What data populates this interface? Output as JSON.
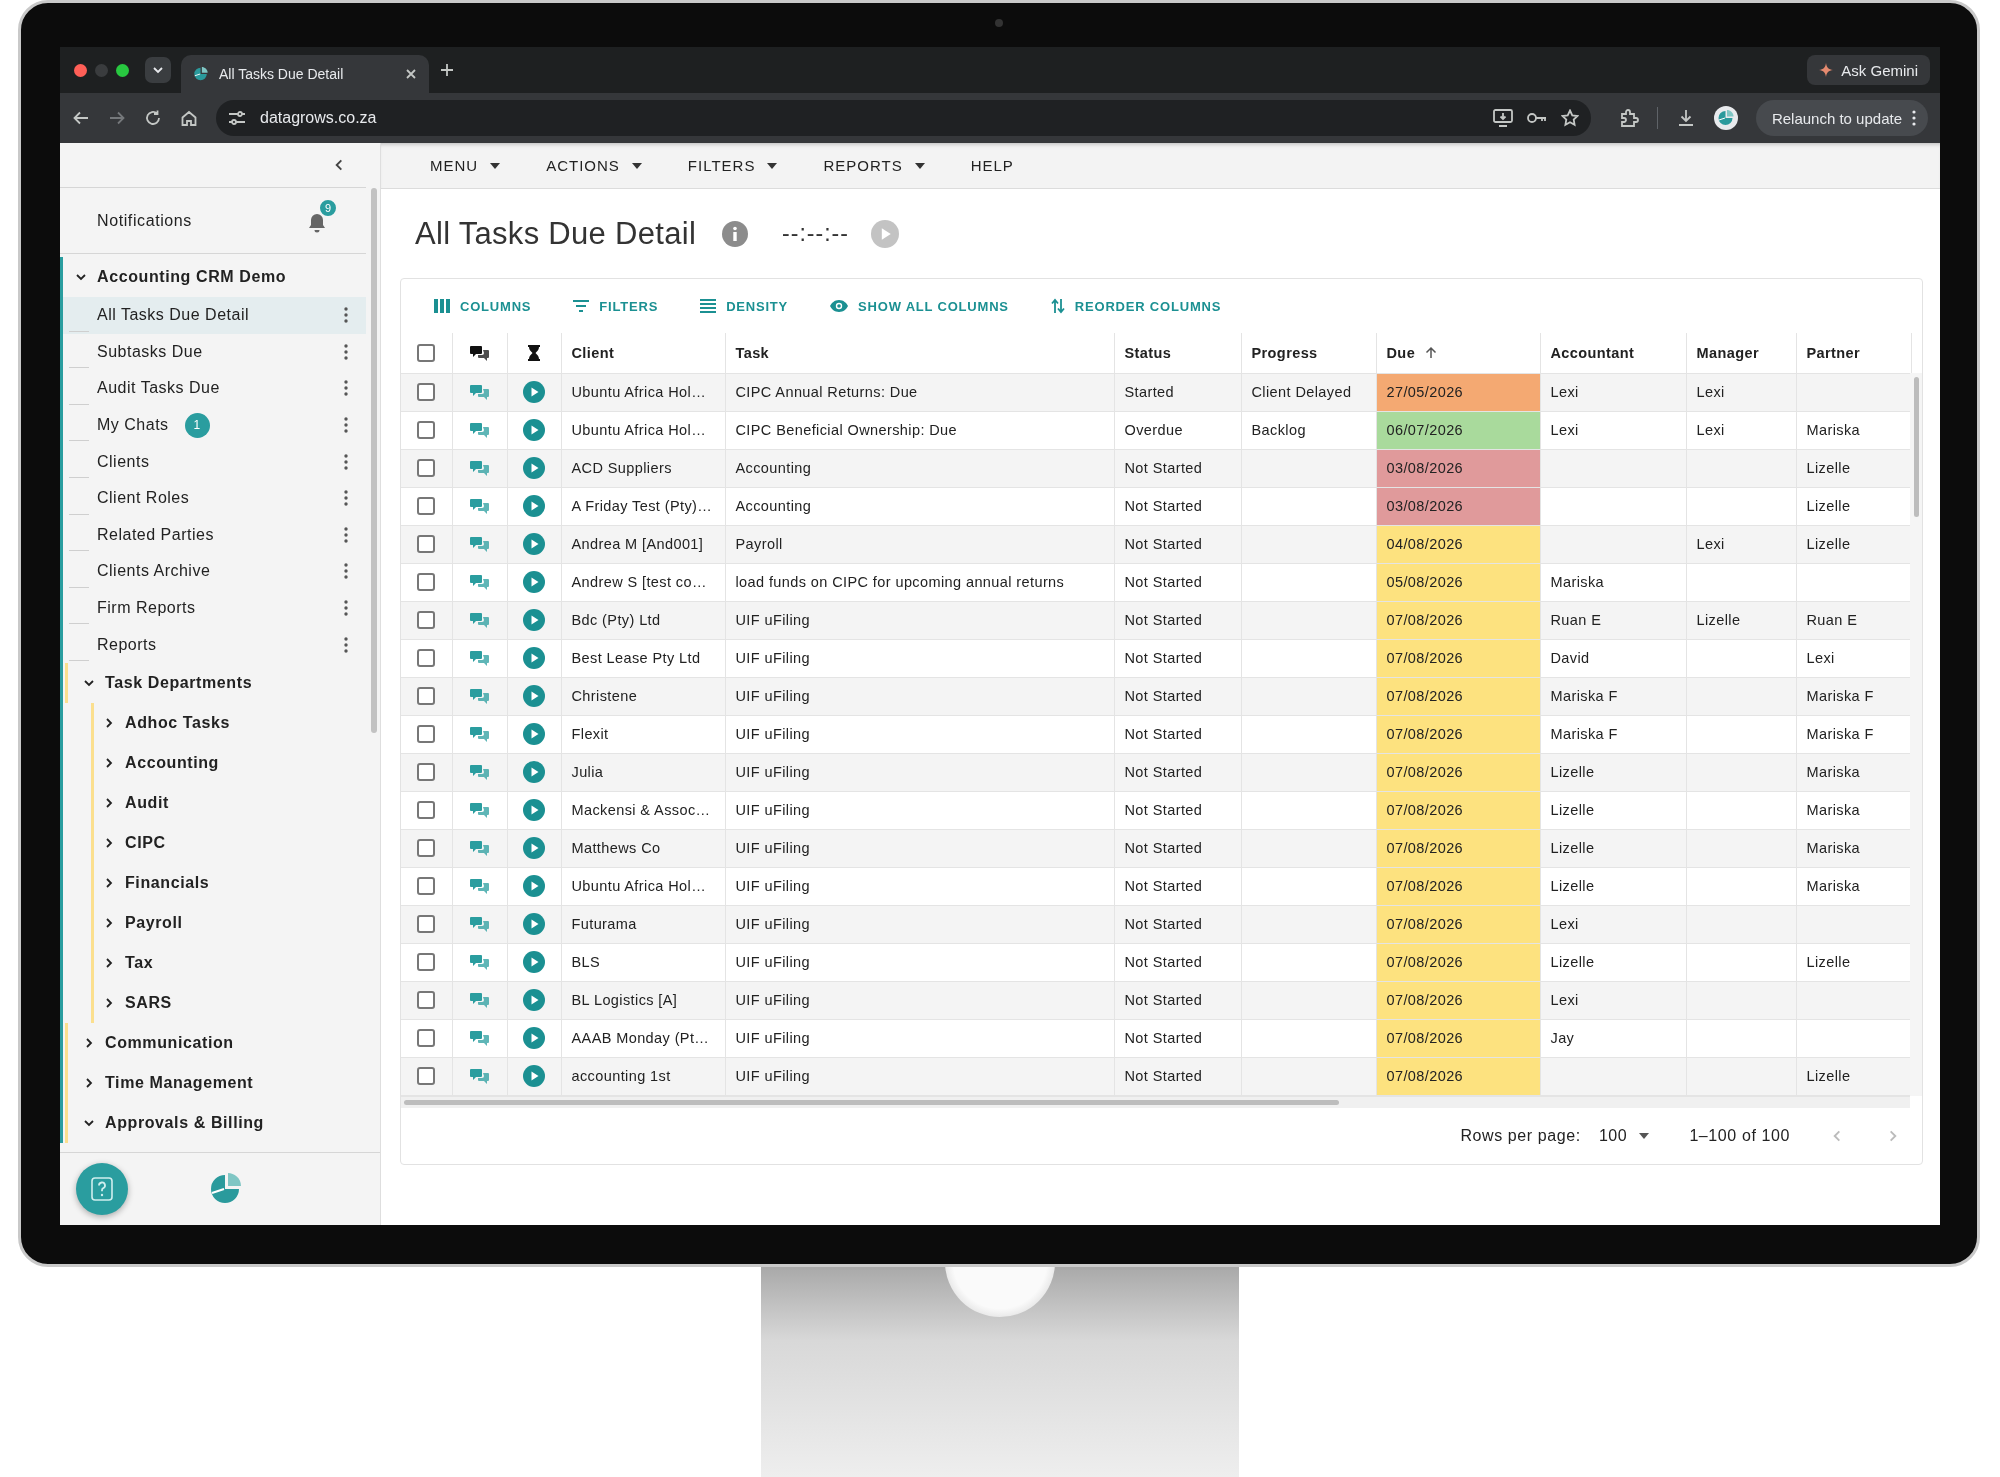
{
  "browser": {
    "tabs": [
      {
        "title": "All Tasks Due Detail",
        "selected": true
      }
    ],
    "url": "datagrows.co.za",
    "gemini_button": "Ask Gemini",
    "relaunch_button": "Relaunch to update"
  },
  "sidebar": {
    "notifications": {
      "label": "Notifications",
      "badge": "9"
    },
    "tree": [
      {
        "label": "Accounting CRM Demo",
        "kind": "folder",
        "expanded": true,
        "children": [
          {
            "label": "All Tasks Due Detail",
            "kind": "page",
            "selected": true
          },
          {
            "label": "Subtasks Due",
            "kind": "page",
            "selected": false
          },
          {
            "label": "Audit Tasks Due",
            "kind": "page",
            "selected": false
          },
          {
            "label": "My Chats",
            "kind": "page",
            "selected": false,
            "badge": "1"
          },
          {
            "label": "Clients",
            "kind": "page",
            "selected": false
          },
          {
            "label": "Client Roles",
            "kind": "page",
            "selected": false
          },
          {
            "label": "Related Parties",
            "kind": "page",
            "selected": false
          },
          {
            "label": "Clients Archive",
            "kind": "page",
            "selected": false
          },
          {
            "label": "Firm Reports",
            "kind": "page",
            "selected": false
          },
          {
            "label": "Reports",
            "kind": "page",
            "selected": false
          },
          {
            "label": "Task Departments",
            "kind": "folder",
            "expanded": true,
            "children": [
              {
                "label": "Adhoc Tasks",
                "kind": "folder",
                "expanded": false
              },
              {
                "label": "Accounting",
                "kind": "folder",
                "expanded": false
              },
              {
                "label": "Audit",
                "kind": "folder",
                "expanded": false
              },
              {
                "label": "CIPC",
                "kind": "folder",
                "expanded": false
              },
              {
                "label": "Financials",
                "kind": "folder",
                "expanded": false
              },
              {
                "label": "Payroll",
                "kind": "folder",
                "expanded": false
              },
              {
                "label": "Tax",
                "kind": "folder",
                "expanded": false
              },
              {
                "label": "SARS",
                "kind": "folder",
                "expanded": false
              }
            ]
          },
          {
            "label": "Communication",
            "kind": "folder",
            "expanded": false
          },
          {
            "label": "Time Management",
            "kind": "folder",
            "expanded": false
          },
          {
            "label": "Approvals & Billing",
            "kind": "folder",
            "expanded": true
          }
        ]
      }
    ]
  },
  "menu": [
    {
      "label": "MENU",
      "dropdown": true
    },
    {
      "label": "ACTIONS",
      "dropdown": true
    },
    {
      "label": "FILTERS",
      "dropdown": true
    },
    {
      "label": "REPORTS",
      "dropdown": true
    },
    {
      "label": "HELP",
      "dropdown": false
    }
  ],
  "page": {
    "title": "All Tasks Due Detail",
    "timer": "--:--:--"
  },
  "toolbar": [
    {
      "label": "COLUMNS",
      "kind": "columns"
    },
    {
      "label": "FILTERS",
      "kind": "filters"
    },
    {
      "label": "DENSITY",
      "kind": "density"
    },
    {
      "label": "SHOW ALL COLUMNS",
      "kind": "show"
    },
    {
      "label": "REORDER COLUMNS",
      "kind": "reorder"
    }
  ],
  "table": {
    "select_all": {
      "checked": false
    },
    "columns": [
      {
        "label": "Client",
        "sorted": false
      },
      {
        "label": "Task",
        "sorted": false
      },
      {
        "label": "Status",
        "sorted": false
      },
      {
        "label": "Progress",
        "sorted": false
      },
      {
        "label": "Due",
        "sorted": true
      },
      {
        "label": "Accountant",
        "sorted": false
      },
      {
        "label": "Manager",
        "sorted": false
      },
      {
        "label": "Partner",
        "sorted": false
      }
    ],
    "rows": [
      {
        "checked": false,
        "client": "Ubuntu Africa Hol…",
        "task": "CIPC Annual Returns: Due",
        "status": "Started",
        "progress": "Client Delayed",
        "due": "27/05/2026",
        "color": "#f4a972",
        "accountant": "Lexi",
        "manager": "Lexi"
      },
      {
        "checked": false,
        "client": "Ubuntu Africa Hol…",
        "task": "CIPC Beneficial Ownership: Due",
        "status": "Overdue",
        "progress": "Backlog",
        "due": "06/07/2026",
        "color": "#a9da9c",
        "accountant": "Lexi",
        "manager": "Lexi",
        "partner": "Mariska"
      },
      {
        "checked": false,
        "client": "ACD Suppliers",
        "task": "Accounting",
        "status": "Not Started",
        "due": "03/08/2026",
        "color": "#e09a9b",
        "partner": "Lizelle"
      },
      {
        "checked": false,
        "client": "A Friday Test (Pty)…",
        "task": "Accounting",
        "status": "Not Started",
        "due": "03/08/2026",
        "color": "#e09a9b",
        "partner": "Lizelle"
      },
      {
        "checked": false,
        "client": "Andrea M [And001]",
        "task": "Payroll",
        "status": "Not Started",
        "due": "04/08/2026",
        "color": "#fde27f",
        "manager": "Lexi",
        "partner": "Lizelle"
      },
      {
        "checked": false,
        "client": "Andrew S [test co…",
        "task": "load funds on CIPC for upcoming annual returns",
        "status": "Not Started",
        "due": "05/08/2026",
        "color": "#fde27f",
        "accountant": "Mariska"
      },
      {
        "checked": false,
        "client": "Bdc (Pty) Ltd",
        "task": "UIF uFiling",
        "status": "Not Started",
        "due": "07/08/2026",
        "color": "#fde27f",
        "accountant": "Ruan E",
        "manager": "Lizelle",
        "partner": "Ruan E"
      },
      {
        "checked": false,
        "client": "Best Lease Pty Ltd",
        "task": "UIF uFiling",
        "status": "Not Started",
        "due": "07/08/2026",
        "color": "#fde27f",
        "accountant": "David",
        "partner": "Lexi"
      },
      {
        "checked": false,
        "client": "Christene",
        "task": "UIF uFiling",
        "status": "Not Started",
        "due": "07/08/2026",
        "color": "#fde27f",
        "accountant": "Mariska F",
        "partner": "Mariska F"
      },
      {
        "checked": false,
        "client": "Flexit",
        "task": "UIF uFiling",
        "status": "Not Started",
        "due": "07/08/2026",
        "color": "#fde27f",
        "accountant": "Mariska F",
        "partner": "Mariska F"
      },
      {
        "checked": false,
        "client": "Julia",
        "task": "UIF uFiling",
        "status": "Not Started",
        "due": "07/08/2026",
        "color": "#fde27f",
        "accountant": "Lizelle",
        "partner": "Mariska"
      },
      {
        "checked": false,
        "client": "Mackensi & Assoc…",
        "task": "UIF uFiling",
        "status": "Not Started",
        "due": "07/08/2026",
        "color": "#fde27f",
        "accountant": "Lizelle",
        "partner": "Mariska"
      },
      {
        "checked": false,
        "client": "Matthews Co",
        "task": "UIF uFiling",
        "status": "Not Started",
        "due": "07/08/2026",
        "color": "#fde27f",
        "accountant": "Lizelle",
        "partner": "Mariska"
      },
      {
        "checked": false,
        "client": "Ubuntu Africa Hol…",
        "task": "UIF uFiling",
        "status": "Not Started",
        "due": "07/08/2026",
        "color": "#fde27f",
        "accountant": "Lizelle",
        "partner": "Mariska"
      },
      {
        "checked": false,
        "client": "Futurama",
        "task": "UIF uFiling",
        "status": "Not Started",
        "due": "07/08/2026",
        "color": "#fde27f",
        "accountant": "Lexi"
      },
      {
        "checked": false,
        "client": "BLS",
        "task": "UIF uFiling",
        "status": "Not Started",
        "due": "07/08/2026",
        "color": "#fde27f",
        "accountant": "Lizelle",
        "partner": "Lizelle"
      },
      {
        "checked": false,
        "client": "BL Logistics [A]",
        "task": "UIF uFiling",
        "status": "Not Started",
        "due": "07/08/2026",
        "color": "#fde27f",
        "accountant": "Lexi"
      },
      {
        "checked": false,
        "client": "AAAB Monday (Pt…",
        "task": "UIF uFiling",
        "status": "Not Started",
        "due": "07/08/2026",
        "color": "#fde27f",
        "accountant": "Jay"
      },
      {
        "checked": false,
        "client": "accounting 1st",
        "task": "UIF uFiling",
        "status": "Not Started",
        "due": "07/08/2026",
        "color": "#fde27f",
        "partner": "Lizelle"
      }
    ],
    "footer": {
      "rows_per_page_label": "Rows per page:",
      "rows_per_page": "100",
      "range": "1–100 of 100",
      "prev_disabled": true,
      "next_disabled": true
    }
  }
}
